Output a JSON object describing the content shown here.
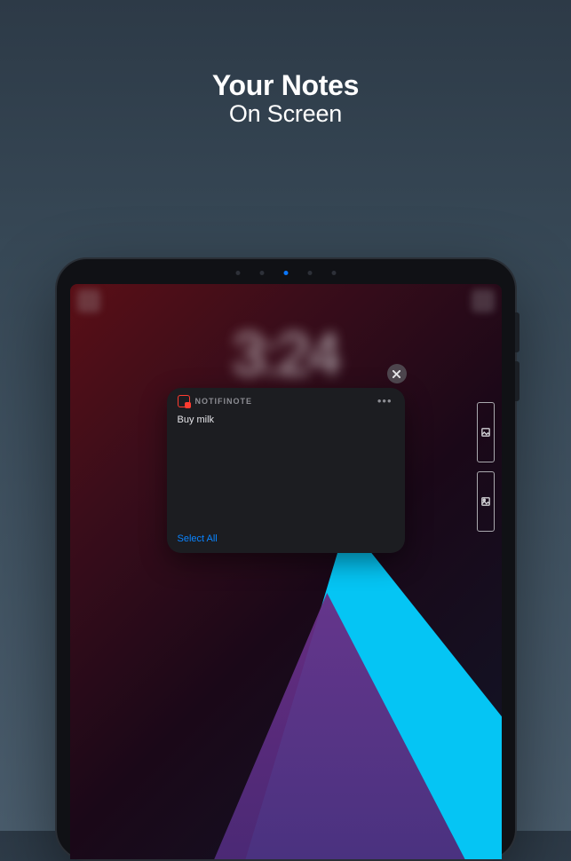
{
  "hero": {
    "title": "Your Notes",
    "subtitle": "On Screen"
  },
  "clock": "3:24",
  "widget": {
    "app_name": "NOTIFINOTE",
    "note": "Buy milk",
    "footer_action": "Select All",
    "close_icon": "close-icon",
    "app_icon": "notifinote-icon",
    "more_icon": "ellipsis-icon"
  },
  "side_icons": {
    "top": "image-icon",
    "bottom": "image-filled-icon"
  }
}
